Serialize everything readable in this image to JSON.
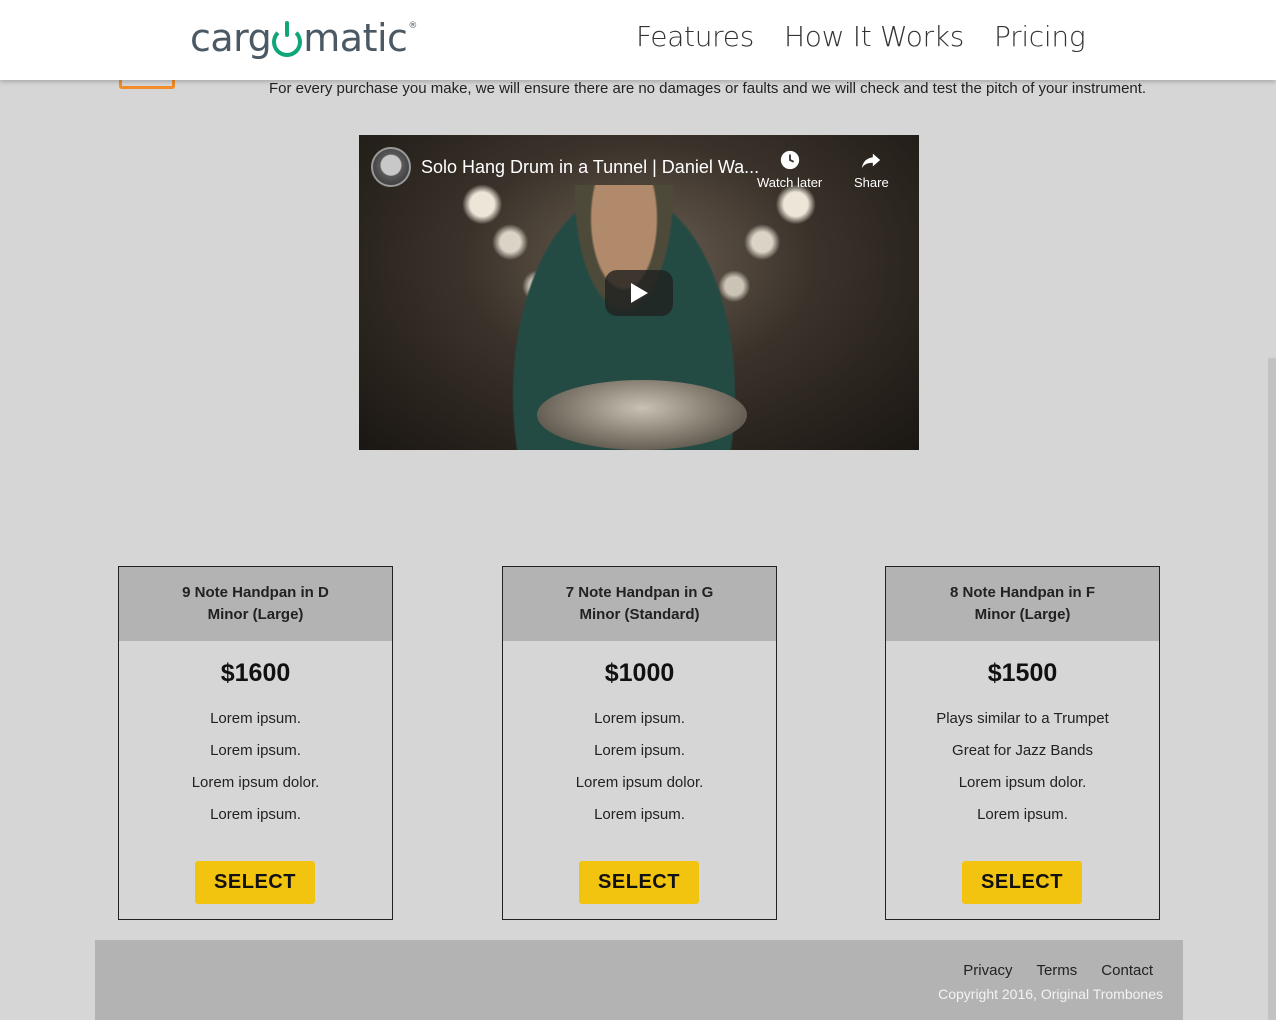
{
  "header": {
    "logo_text_before": "carg",
    "logo_text_after": "matic",
    "nav": [
      {
        "label": "Features"
      },
      {
        "label": "How It Works"
      },
      {
        "label": "Pricing"
      }
    ]
  },
  "intro": {
    "tagline": "For every purchase you make, we will ensure there are no damages or faults and we will check and test the pitch of your instrument."
  },
  "video": {
    "title": "Solo Hang Drum in a Tunnel | Daniel Wa...",
    "watch_later_label": "Watch later",
    "share_label": "Share"
  },
  "plans": [
    {
      "name": "9 Note Handpan in D Minor (Large)",
      "price": "$1600",
      "features": [
        "Lorem ipsum.",
        "Lorem ipsum.",
        "Lorem ipsum dolor.",
        "Lorem ipsum."
      ],
      "button": "SELECT"
    },
    {
      "name": "7 Note Handpan in G Minor (Standard)",
      "price": "$1000",
      "features": [
        "Lorem ipsum.",
        "Lorem ipsum.",
        "Lorem ipsum dolor.",
        "Lorem ipsum."
      ],
      "button": "SELECT"
    },
    {
      "name": "8 Note Handpan in F Minor (Large)",
      "price": "$1500",
      "features": [
        "Plays similar to a Trumpet",
        "Great for Jazz Bands",
        "Lorem ipsum dolor.",
        "Lorem ipsum."
      ],
      "button": "SELECT"
    }
  ],
  "footer": {
    "links": [
      {
        "label": "Privacy"
      },
      {
        "label": "Terms"
      },
      {
        "label": "Contact"
      }
    ],
    "copyright": "Copyright 2016, Original Trombones"
  },
  "colors": {
    "background": "#d6d6d6",
    "header_bg": "#ffffff",
    "logo_text": "#4a5963",
    "logo_accent": "#0fa67a",
    "card_header": "#b3b3b3",
    "button": "#f2c40f",
    "footer_bg": "#b3b3b3",
    "icon_orange": "#f28c28"
  },
  "icons": [
    "power-icon",
    "clock-icon",
    "share-arrow-icon",
    "play-icon",
    "channel-avatar"
  ]
}
